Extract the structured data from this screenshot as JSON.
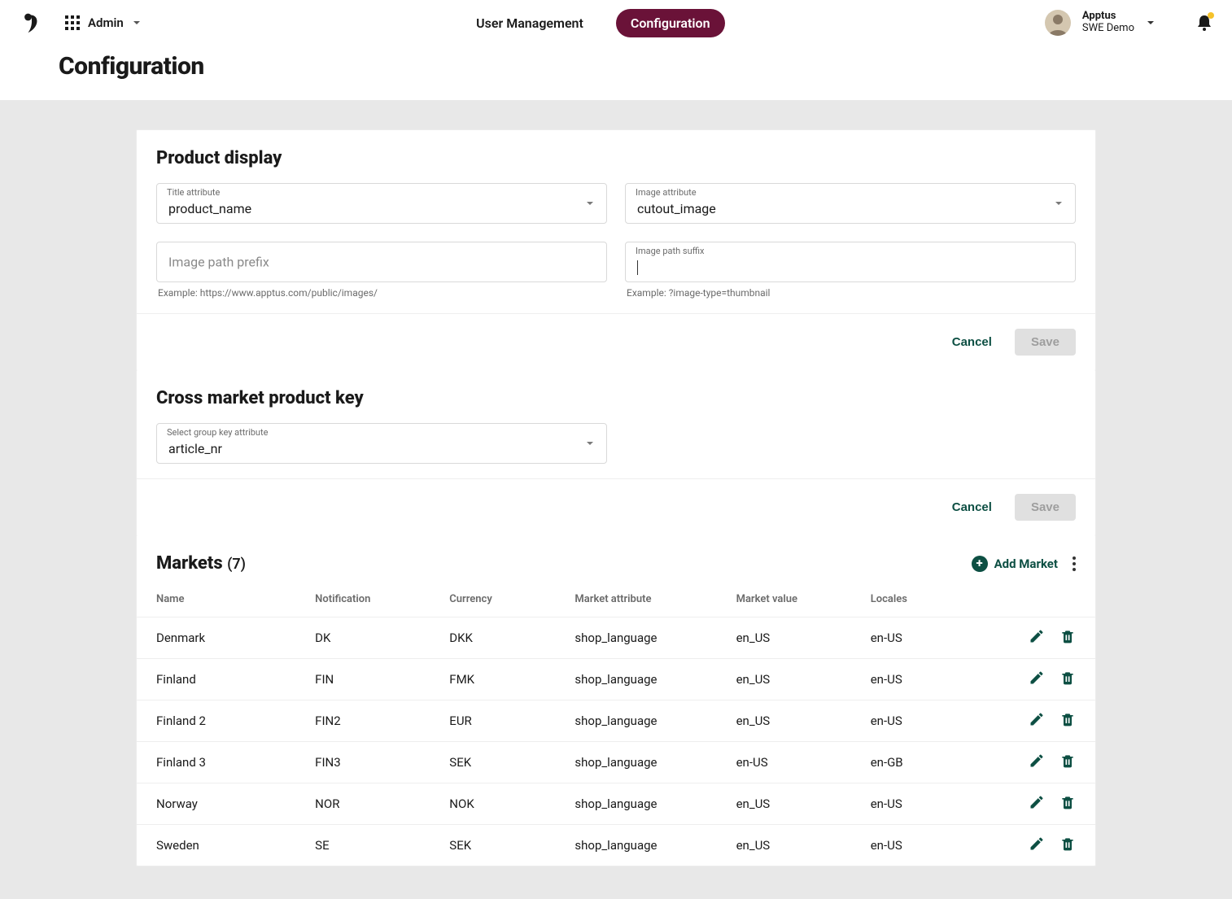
{
  "header": {
    "app_label": "Admin",
    "nav": {
      "user_management": "User Management",
      "configuration": "Configuration"
    },
    "user": {
      "org": "Apptus",
      "env": "SWE Demo"
    }
  },
  "page": {
    "title": "Configuration"
  },
  "product_display": {
    "title": "Product display",
    "title_attribute": {
      "label": "Title attribute",
      "value": "product_name"
    },
    "image_attribute": {
      "label": "Image attribute",
      "value": "cutout_image"
    },
    "image_path_prefix": {
      "label": "Image path prefix",
      "value": "",
      "helper": "Example: https://www.apptus.com/public/images/"
    },
    "image_path_suffix": {
      "label": "Image path suffix",
      "value": "",
      "helper": "Example: ?image-type=thumbnail"
    },
    "cancel_label": "Cancel",
    "save_label": "Save"
  },
  "cross_market": {
    "title": "Cross market product key",
    "group_key": {
      "label": "Select group key attribute",
      "value": "article_nr"
    },
    "cancel_label": "Cancel",
    "save_label": "Save"
  },
  "markets": {
    "title": "Markets",
    "count_display": "(7)",
    "add_label": "Add Market",
    "columns": {
      "name": "Name",
      "notification": "Notification",
      "currency": "Currency",
      "market_attribute": "Market attribute",
      "market_value": "Market value",
      "locales": "Locales"
    },
    "rows": [
      {
        "name": "Denmark",
        "notification": "DK",
        "currency": "DKK",
        "market_attribute": "shop_language",
        "market_value": "en_US",
        "locales": "en-US"
      },
      {
        "name": "Finland",
        "notification": "FIN",
        "currency": "FMK",
        "market_attribute": "shop_language",
        "market_value": "en_US",
        "locales": "en-US"
      },
      {
        "name": "Finland 2",
        "notification": "FIN2",
        "currency": "EUR",
        "market_attribute": "shop_language",
        "market_value": "en_US",
        "locales": "en-US"
      },
      {
        "name": "Finland 3",
        "notification": "FIN3",
        "currency": "SEK",
        "market_attribute": "shop_language",
        "market_value": "en-US",
        "locales": "en-GB"
      },
      {
        "name": "Norway",
        "notification": "NOR",
        "currency": "NOK",
        "market_attribute": "shop_language",
        "market_value": "en_US",
        "locales": "en-US"
      },
      {
        "name": "Sweden",
        "notification": "SE",
        "currency": "SEK",
        "market_attribute": "shop_language",
        "market_value": "en_US",
        "locales": "en-US"
      }
    ]
  }
}
